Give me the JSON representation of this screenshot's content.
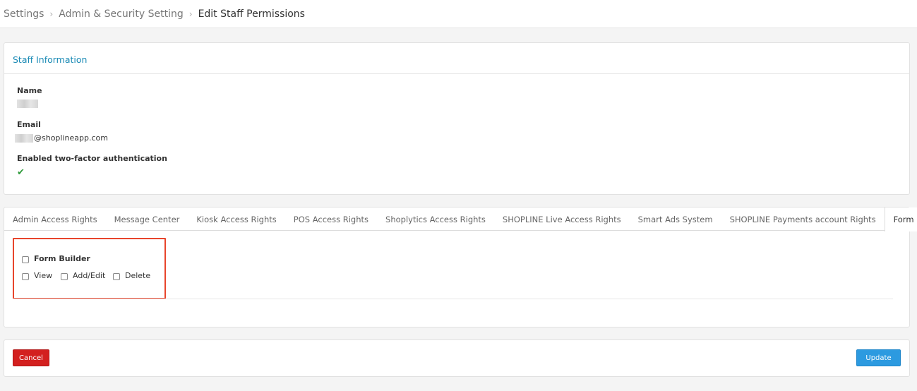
{
  "breadcrumb": {
    "items": [
      "Settings",
      "Admin & Security Setting",
      "Edit Staff Permissions"
    ],
    "separator_icon": "chevron-right-icon"
  },
  "staff_info": {
    "title": "Staff Information",
    "name_label": "Name",
    "email_label": "Email",
    "email_suffix": "@shoplineapp.com",
    "two_factor_label": "Enabled two-factor authentication",
    "two_factor_icon": "check-icon"
  },
  "tabs": [
    {
      "label": "Admin Access Rights",
      "active": false
    },
    {
      "label": "Message Center",
      "active": false
    },
    {
      "label": "Kiosk Access Rights",
      "active": false
    },
    {
      "label": "POS Access Rights",
      "active": false
    },
    {
      "label": "Shoplytics Access Rights",
      "active": false
    },
    {
      "label": "SHOPLINE Live Access Rights",
      "active": false
    },
    {
      "label": "Smart Ads System",
      "active": false
    },
    {
      "label": "SHOPLINE Payments account Rights",
      "active": false
    },
    {
      "label": "Form Builder",
      "active": true
    }
  ],
  "permissions": {
    "group_label": "Form Builder",
    "options": [
      {
        "label": "View",
        "checked": false
      },
      {
        "label": "Add/Edit",
        "checked": false
      },
      {
        "label": "Delete",
        "checked": false
      }
    ]
  },
  "actions": {
    "cancel_label": "Cancel",
    "update_label": "Update"
  },
  "colors": {
    "link": "#1a8ab5",
    "cancel": "#d3201f",
    "update": "#2c9ae0",
    "highlight": "#e8452c",
    "check": "#2e9a3b"
  }
}
